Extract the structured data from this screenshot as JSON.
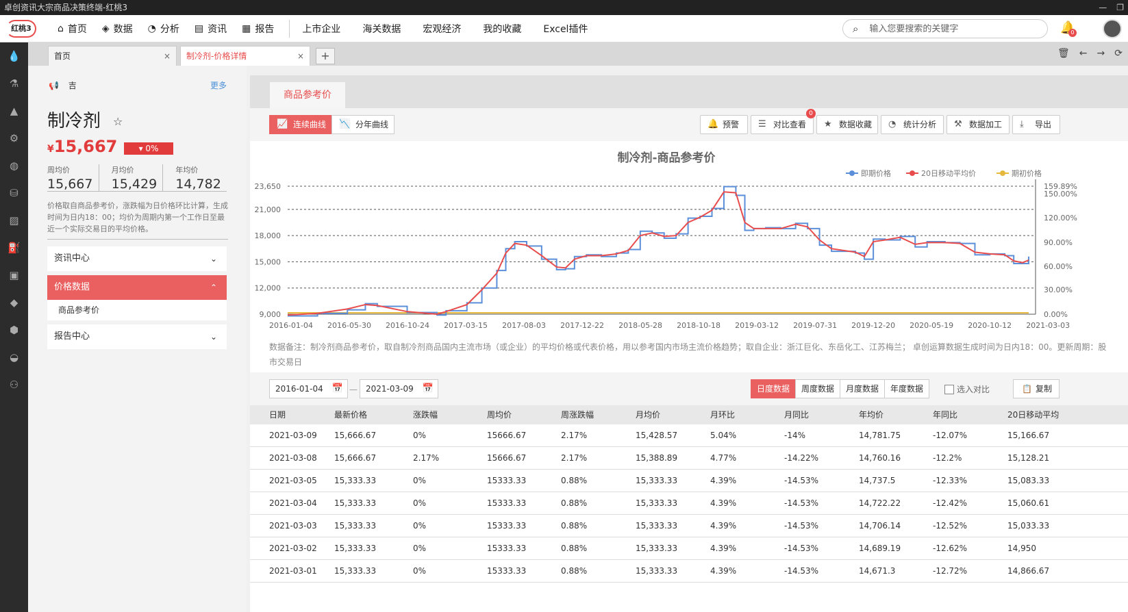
{
  "window": {
    "title": "卓创资讯大宗商品决策终端-红桃3",
    "controls": [
      "—",
      "❐"
    ]
  },
  "nav": {
    "logo": "红桃3",
    "primary": [
      {
        "label": "首页",
        "icon": "⌂"
      },
      {
        "label": "数据",
        "icon": "◈"
      },
      {
        "label": "分析",
        "icon": "◔"
      },
      {
        "label": "资讯",
        "icon": "▤"
      },
      {
        "label": "报告",
        "icon": "▦"
      }
    ],
    "secondary": [
      "上市企业",
      "海关数据",
      "宏观经济",
      "我的收藏",
      "Excel插件"
    ],
    "search_placeholder": "输入您要搜索的关键字",
    "search_icon": "⌕",
    "bell_icon": "🔔",
    "bell_count": "0"
  },
  "sidebar_icons": [
    "💧",
    "⚗",
    "▲",
    "⚙",
    "◍",
    "⛁",
    "▨",
    "⛽",
    "▣",
    "◆",
    "⬢",
    "◒",
    "⚇"
  ],
  "tabs": {
    "items": [
      {
        "label": "首页",
        "close": "×"
      },
      {
        "label": "制冷剂-价格详情",
        "close": "×"
      }
    ],
    "add": "+",
    "tools": [
      "🗑",
      "←",
      "→",
      "⟳"
    ]
  },
  "info": {
    "notice_icon": "📢",
    "notice_text": "吉",
    "more": "更多",
    "product_name": "制冷剂",
    "star_icon": "☆",
    "currency": "¥",
    "price": "15,667",
    "change": "▾ 0%",
    "averages": [
      {
        "label": "周均价",
        "value": "15,667"
      },
      {
        "label": "月均价",
        "value": "15,429"
      },
      {
        "label": "年均价",
        "value": "14,782"
      }
    ],
    "description": "价格取自商品参考价，涨跌幅为日价格环比计算，生成时间为日内18：00；均价为周期内第一个工作日至最近一个实际交易日的平均价格。",
    "menu": [
      {
        "label": "资讯中心",
        "chev": "⌄",
        "active": false
      },
      {
        "label": "价格数据",
        "chev": "⌃",
        "active": true
      },
      {
        "label": "报告中心",
        "chev": "⌄",
        "active": false
      }
    ],
    "submenu": [
      "商品参考价"
    ]
  },
  "main": {
    "tab": "商品参考价",
    "chart_modes": [
      {
        "label": "连续曲线",
        "icon": "📈"
      },
      {
        "label": "分年曲线",
        "icon": "📉"
      }
    ],
    "tools": [
      {
        "label": "预警",
        "icon": "🔔"
      },
      {
        "label": "对比查看",
        "icon": "☰",
        "badge": "0"
      },
      {
        "label": "数据收藏",
        "icon": "★"
      },
      {
        "label": "统计分析",
        "icon": "◔"
      },
      {
        "label": "数据加工",
        "icon": "⚒"
      },
      {
        "label": "导出",
        "icon": "⤓"
      }
    ],
    "note": "数据备注：制冷剂商品参考价，取自制冷剂商品国内主流市场（或企业）的平均价格或代表价格，用以参考国内市场主流价格趋势；取自企业：浙江巨化、东岳化工、江苏梅兰；  卓创运算数据生成时间为日内18：00。更新周期：股市交易日",
    "date_from": "2016-01-04",
    "date_to": "2021-03-09",
    "date_dash": "—",
    "cal_icon": "📅",
    "periods": [
      {
        "label": "日度数据",
        "active": true
      },
      {
        "label": "周度数据",
        "active": false
      },
      {
        "label": "月度数据",
        "active": false
      },
      {
        "label": "年度数据",
        "active": false
      }
    ],
    "compare_label": "选入对比",
    "copy_label": "复制",
    "copy_icon": "📋"
  },
  "chart_data": {
    "type": "line",
    "title": "制冷剂-商品参考价",
    "legend_position": "top-right",
    "series": [
      {
        "name": "即期价格",
        "color": "#5b8fd9",
        "axis": "left"
      },
      {
        "name": "20日移动平均价",
        "color": "#e84c4c",
        "axis": "left"
      },
      {
        "name": "期初价格",
        "color": "#e6b83c",
        "axis": "right"
      }
    ],
    "y_left": {
      "min": 9000,
      "max": 23650,
      "ticks": [
        "9,000",
        "12,000",
        "15,000",
        "18,000",
        "21,000",
        "23,650"
      ],
      "tick_values": [
        9000,
        12000,
        15000,
        18000,
        21000,
        23650
      ]
    },
    "y_right": {
      "ticks": [
        "0.00%",
        "30.00%",
        "60.00%",
        "90.00%",
        "120.00%",
        "150.00%",
        "159.89%"
      ]
    },
    "x_ticks": [
      "2016-01-04",
      "2016-05-30",
      "2016-10-24",
      "2017-03-15",
      "2017-08-03",
      "2017-12-22",
      "2018-05-28",
      "2018-10-18",
      "2019-03-12",
      "2019-07-31",
      "2019-12-20",
      "2020-05-19",
      "2020-10-12",
      "2021-03-03"
    ],
    "grid": true,
    "spot_price_points": [
      [
        0,
        8800
      ],
      [
        1,
        9100
      ],
      [
        2,
        9500
      ],
      [
        2.6,
        10200
      ],
      [
        3,
        9900
      ],
      [
        4,
        9200
      ],
      [
        5,
        8900
      ],
      [
        5.3,
        9400
      ],
      [
        6,
        10300
      ],
      [
        6.5,
        12000
      ],
      [
        7,
        14000
      ],
      [
        7.3,
        16500
      ],
      [
        7.6,
        17300
      ],
      [
        8,
        16800
      ],
      [
        8.5,
        15300
      ],
      [
        9,
        14100
      ],
      [
        9.3,
        14200
      ],
      [
        9.6,
        15600
      ],
      [
        10,
        15800
      ],
      [
        10.5,
        15600
      ],
      [
        11,
        16000
      ],
      [
        11.4,
        16400
      ],
      [
        11.8,
        18500
      ],
      [
        12.2,
        18300
      ],
      [
        12.6,
        17700
      ],
      [
        13,
        18200
      ],
      [
        13.4,
        20000
      ],
      [
        13.8,
        20200
      ],
      [
        14.2,
        21100
      ],
      [
        14.6,
        23600
      ],
      [
        15,
        22600
      ],
      [
        15.3,
        18600
      ],
      [
        15.6,
        18800
      ],
      [
        16,
        18900
      ],
      [
        16.5,
        18800
      ],
      [
        17,
        19400
      ],
      [
        17.4,
        18800
      ],
      [
        17.8,
        16900
      ],
      [
        18.2,
        16200
      ],
      [
        18.6,
        16200
      ],
      [
        19,
        16000
      ],
      [
        19.3,
        15300
      ],
      [
        19.6,
        17600
      ],
      [
        20,
        17500
      ],
      [
        20.5,
        17900
      ],
      [
        21,
        16700
      ],
      [
        21.4,
        17300
      ],
      [
        22,
        17200
      ],
      [
        22.5,
        17100
      ],
      [
        23,
        15800
      ],
      [
        23.5,
        15900
      ],
      [
        24,
        15700
      ],
      [
        24.3,
        14800
      ],
      [
        24.6,
        14800
      ],
      [
        24.8,
        15600
      ]
    ],
    "ma20_points": [
      [
        0,
        8900
      ],
      [
        1,
        9100
      ],
      [
        2,
        9600
      ],
      [
        2.6,
        10100
      ],
      [
        3,
        10000
      ],
      [
        4,
        9300
      ],
      [
        5,
        9000
      ],
      [
        5.3,
        9300
      ],
      [
        6,
        10100
      ],
      [
        6.5,
        11800
      ],
      [
        7,
        13700
      ],
      [
        7.3,
        16000
      ],
      [
        7.6,
        17100
      ],
      [
        8,
        16900
      ],
      [
        8.5,
        15700
      ],
      [
        9,
        14400
      ],
      [
        9.3,
        14300
      ],
      [
        9.6,
        15300
      ],
      [
        10,
        15700
      ],
      [
        10.5,
        15700
      ],
      [
        11,
        15900
      ],
      [
        11.4,
        16300
      ],
      [
        11.8,
        18000
      ],
      [
        12.2,
        18300
      ],
      [
        12.6,
        17900
      ],
      [
        13,
        18000
      ],
      [
        13.4,
        19500
      ],
      [
        13.8,
        20100
      ],
      [
        14.2,
        20900
      ],
      [
        14.6,
        23000
      ],
      [
        15,
        22900
      ],
      [
        15.3,
        19500
      ],
      [
        15.6,
        18800
      ],
      [
        16,
        18800
      ],
      [
        16.5,
        18800
      ],
      [
        17,
        19300
      ],
      [
        17.4,
        19000
      ],
      [
        17.8,
        17500
      ],
      [
        18.2,
        16500
      ],
      [
        18.6,
        16300
      ],
      [
        19,
        16100
      ],
      [
        19.3,
        15600
      ],
      [
        19.6,
        17300
      ],
      [
        20,
        17500
      ],
      [
        20.5,
        17800
      ],
      [
        21,
        17000
      ],
      [
        21.4,
        17200
      ],
      [
        22,
        17200
      ],
      [
        22.5,
        17100
      ],
      [
        23,
        16100
      ],
      [
        23.5,
        15900
      ],
      [
        24,
        15800
      ],
      [
        24.3,
        15100
      ],
      [
        24.6,
        14900
      ],
      [
        24.8,
        15200
      ]
    ],
    "initial_price_pct": 0
  },
  "table": {
    "headers": [
      "日期",
      "最新价格",
      "涨跌幅",
      "周均价",
      "周涨跌幅",
      "月均价",
      "月环比",
      "月同比",
      "年均价",
      "年同比",
      "20日移动平均"
    ],
    "rows": [
      [
        "2021-03-09",
        "15,666.67",
        "0%",
        "15666.67",
        "2.17%",
        "15,428.57",
        "5.04%",
        "-14%",
        "14,781.75",
        "-12.07%",
        "15,166.67"
      ],
      [
        "2021-03-08",
        "15,666.67",
        "2.17%",
        "15666.67",
        "2.17%",
        "15,388.89",
        "4.77%",
        "-14.22%",
        "14,760.16",
        "-12.2%",
        "15,128.21"
      ],
      [
        "2021-03-05",
        "15,333.33",
        "0%",
        "15333.33",
        "0.88%",
        "15,333.33",
        "4.39%",
        "-14.53%",
        "14,737.5",
        "-12.33%",
        "15,083.33"
      ],
      [
        "2021-03-04",
        "15,333.33",
        "0%",
        "15333.33",
        "0.88%",
        "15,333.33",
        "4.39%",
        "-14.53%",
        "14,722.22",
        "-12.42%",
        "15,060.61"
      ],
      [
        "2021-03-03",
        "15,333.33",
        "0%",
        "15333.33",
        "0.88%",
        "15,333.33",
        "4.39%",
        "-14.53%",
        "14,706.14",
        "-12.52%",
        "15,033.33"
      ],
      [
        "2021-03-02",
        "15,333.33",
        "0%",
        "15333.33",
        "0.88%",
        "15,333.33",
        "4.39%",
        "-14.53%",
        "14,689.19",
        "-12.62%",
        "14,950"
      ],
      [
        "2021-03-01",
        "15,333.33",
        "0%",
        "15333.33",
        "0.88%",
        "15,333.33",
        "4.39%",
        "-14.53%",
        "14,671.3",
        "-12.72%",
        "14,866.67"
      ]
    ]
  }
}
